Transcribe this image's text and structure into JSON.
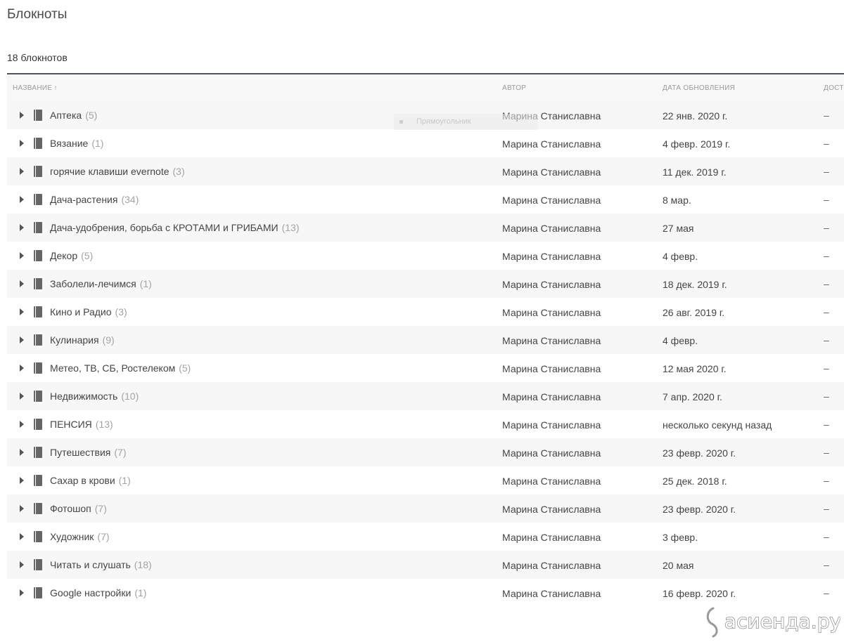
{
  "page": {
    "title": "Блокноты",
    "count_label": "18 блокнотов"
  },
  "columns": {
    "name": "НАЗВАНИЕ",
    "sort_indicator": "↑",
    "author": "АВТОР",
    "date": "ДАТА ОБНОВЛЕНИЯ",
    "access": "ДОСТ"
  },
  "drag_ghost": {
    "label": "Прямоугольник"
  },
  "notebooks": [
    {
      "name": "Аптека",
      "count": "(5)",
      "author": "Марина Станиславна",
      "updated": "22 янв. 2020 г.",
      "access": "–"
    },
    {
      "name": "Вязание",
      "count": "(1)",
      "author": "Марина Станиславна",
      "updated": "4 февр. 2019 г.",
      "access": "–"
    },
    {
      "name": "горячие клавиши evernote",
      "count": "(3)",
      "author": "Марина Станиславна",
      "updated": "11 дек. 2019 г.",
      "access": "–"
    },
    {
      "name": "Дача-растения",
      "count": "(34)",
      "author": "Марина Станиславна",
      "updated": "8 мар.",
      "access": "–"
    },
    {
      "name": "Дача-удобрения, борьба с КРОТАМИ и ГРИБАМИ",
      "count": "(13)",
      "author": "Марина Станиславна",
      "updated": "27 мая",
      "access": "–"
    },
    {
      "name": "Декор",
      "count": "(5)",
      "author": "Марина Станиславна",
      "updated": "4 февр.",
      "access": "–"
    },
    {
      "name": "Заболели-лечимся",
      "count": "(1)",
      "author": "Марина Станиславна",
      "updated": "18 дек. 2019 г.",
      "access": "–"
    },
    {
      "name": "Кино и Радио",
      "count": "(3)",
      "author": "Марина Станиславна",
      "updated": "26 авг. 2019 г.",
      "access": "–"
    },
    {
      "name": "Кулинария",
      "count": "(9)",
      "author": "Марина Станиславна",
      "updated": "4 февр.",
      "access": "–"
    },
    {
      "name": "Метео, ТВ, СБ, Ростелеком",
      "count": "(5)",
      "author": "Марина Станиславна",
      "updated": "12 мая 2020 г.",
      "access": "–"
    },
    {
      "name": "Недвижимость",
      "count": "(10)",
      "author": "Марина Станиславна",
      "updated": "7 апр. 2020 г.",
      "access": "–"
    },
    {
      "name": "ПЕНСИЯ",
      "count": "(13)",
      "author": "Марина Станиславна",
      "updated": "несколько секунд назад",
      "access": "–"
    },
    {
      "name": "Путешествия",
      "count": "(7)",
      "author": "Марина Станиславна",
      "updated": "23 февр. 2020 г.",
      "access": "–"
    },
    {
      "name": "Сахар в крови",
      "count": "(1)",
      "author": "Марина Станиславна",
      "updated": "25 дек. 2018 г.",
      "access": "–"
    },
    {
      "name": "Фотошоп",
      "count": "(7)",
      "author": "Марина Станиславна",
      "updated": "23 февр. 2020 г.",
      "access": "–"
    },
    {
      "name": "Художник",
      "count": "(7)",
      "author": "Марина Станиславна",
      "updated": "3 февр.",
      "access": "–"
    },
    {
      "name": "Читать и слушать",
      "count": "(18)",
      "author": "Марина Станиславна",
      "updated": "20 мая",
      "access": "–"
    },
    {
      "name": "Google настройки",
      "count": "(1)",
      "author": "Марина Станиславна",
      "updated": "16 февр. 2020 г.",
      "access": "–"
    }
  ],
  "watermark": {
    "text": "асиенда.ру"
  }
}
